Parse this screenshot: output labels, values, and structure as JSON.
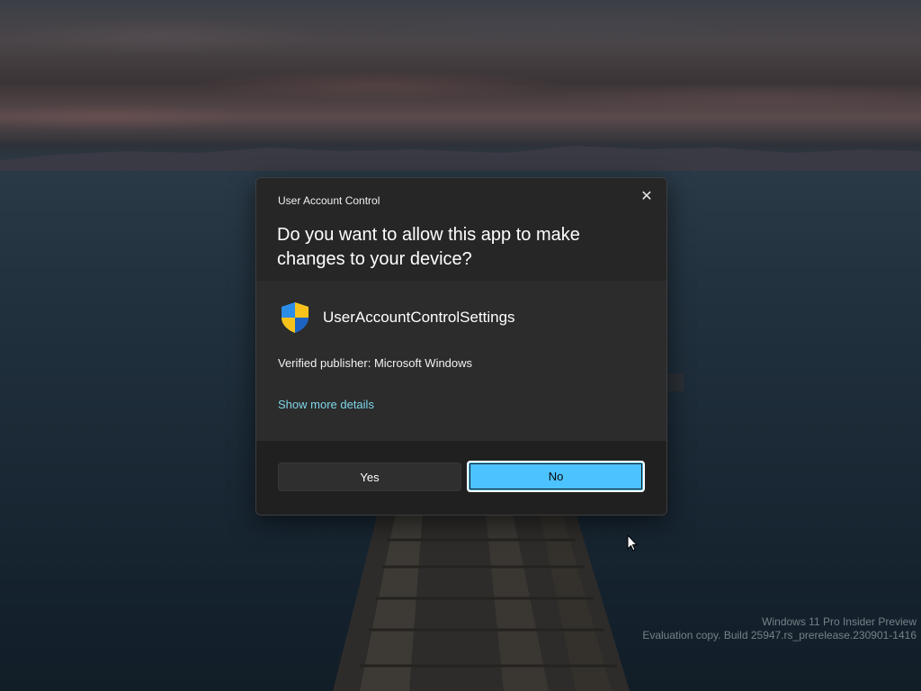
{
  "dialog": {
    "title": "User Account Control",
    "question": "Do you want to allow this app to make changes to your device?",
    "app_name": "UserAccountControlSettings",
    "publisher": "Verified publisher: Microsoft Windows",
    "more_details": "Show more details",
    "yes_label": "Yes",
    "no_label": "No",
    "close_glyph": "✕",
    "shield_icon": "uac-shield-icon",
    "accent_color": "#4cc2ff",
    "link_color": "#7fd6e8"
  },
  "watermark": {
    "line1": "Windows 11 Pro Insider Preview",
    "line2": "Evaluation copy. Build 25947.rs_prerelease.230901-1416"
  }
}
